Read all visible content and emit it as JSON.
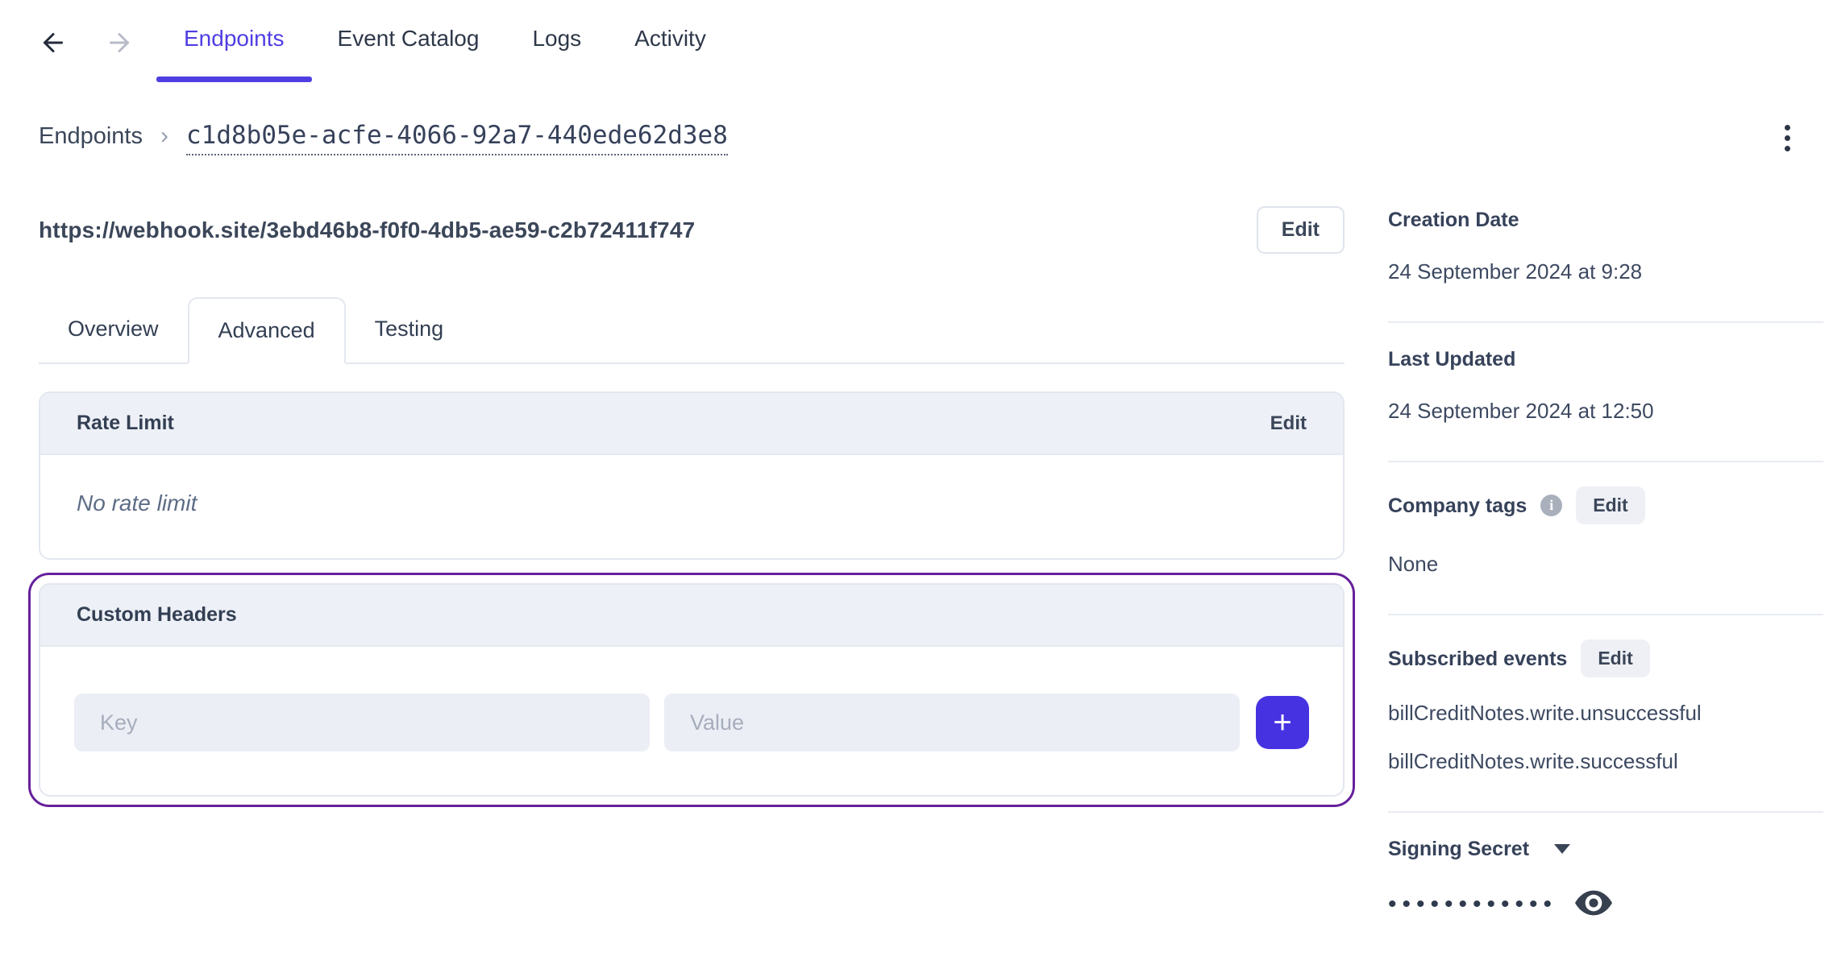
{
  "top_nav": {
    "back_icon": "arrow-left",
    "forward_icon": "arrow-right",
    "tabs": [
      {
        "label": "Endpoints",
        "active": true
      },
      {
        "label": "Event Catalog",
        "active": false
      },
      {
        "label": "Logs",
        "active": false
      },
      {
        "label": "Activity",
        "active": false
      }
    ]
  },
  "breadcrumb": {
    "root": "Endpoints",
    "separator": "›",
    "endpoint_id": "c1d8b05e-acfe-4066-92a7-440ede62d3e8"
  },
  "kebab_icon": "three-dots-vertical",
  "endpoint": {
    "url": "https://webhook.site/3ebd46b8-f0f0-4db5-ae59-c2b72411f747",
    "edit_label": "Edit"
  },
  "detail_tabs": [
    {
      "label": "Overview",
      "active": false
    },
    {
      "label": "Advanced",
      "active": true
    },
    {
      "label": "Testing",
      "active": false
    }
  ],
  "rate_limit_card": {
    "title": "Rate Limit",
    "edit_label": "Edit",
    "empty_text": "No rate limit"
  },
  "custom_headers_card": {
    "title": "Custom Headers",
    "key_placeholder": "Key",
    "value_placeholder": "Value",
    "add_label": "+",
    "highlight_ring_color": "#65209b",
    "add_button_color": "#4632e1"
  },
  "sidebar": {
    "creation_date": {
      "label": "Creation Date",
      "value": "24 September 2024 at 9:28"
    },
    "last_updated": {
      "label": "Last Updated",
      "value": "24 September 2024 at 12:50"
    },
    "company_tags": {
      "label": "Company tags",
      "info_icon": "i",
      "edit_label": "Edit",
      "value": "None"
    },
    "subscribed_events": {
      "label": "Subscribed events",
      "edit_label": "Edit",
      "events": [
        "billCreditNotes.write.unsuccessful",
        "billCreditNotes.write.successful"
      ]
    },
    "signing_secret": {
      "label": "Signing Secret",
      "masked_value": "••••••••••••",
      "reveal_icon": "eye"
    }
  },
  "colors": {
    "accent_indigo": "#4f3ee3",
    "ring_purple": "#65209b",
    "text_dark": "#3a4457",
    "card_header_bg": "#edf0f6",
    "input_bg": "#eceef5"
  }
}
